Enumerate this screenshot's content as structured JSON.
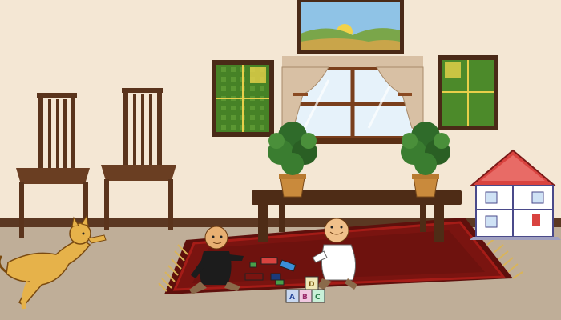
{
  "scene": {
    "type": "illustrated living room scene",
    "colors": {
      "wall": "#f4e7d4",
      "floor": "#bfae98",
      "baseboard": "#5b3822",
      "rug": "#7a1410",
      "rug_border": "#a51c17",
      "wood": "#5a341c",
      "window_frame": "#7a3f1c",
      "curtain": "#d8c0a4",
      "plant": "#2f6b2a",
      "pot": "#c98a3c",
      "cat": "#e6b24a",
      "dollhouse_roof": "#d9433f"
    }
  },
  "toy_blocks": {
    "letters": [
      "A",
      "B",
      "C",
      "D"
    ]
  }
}
